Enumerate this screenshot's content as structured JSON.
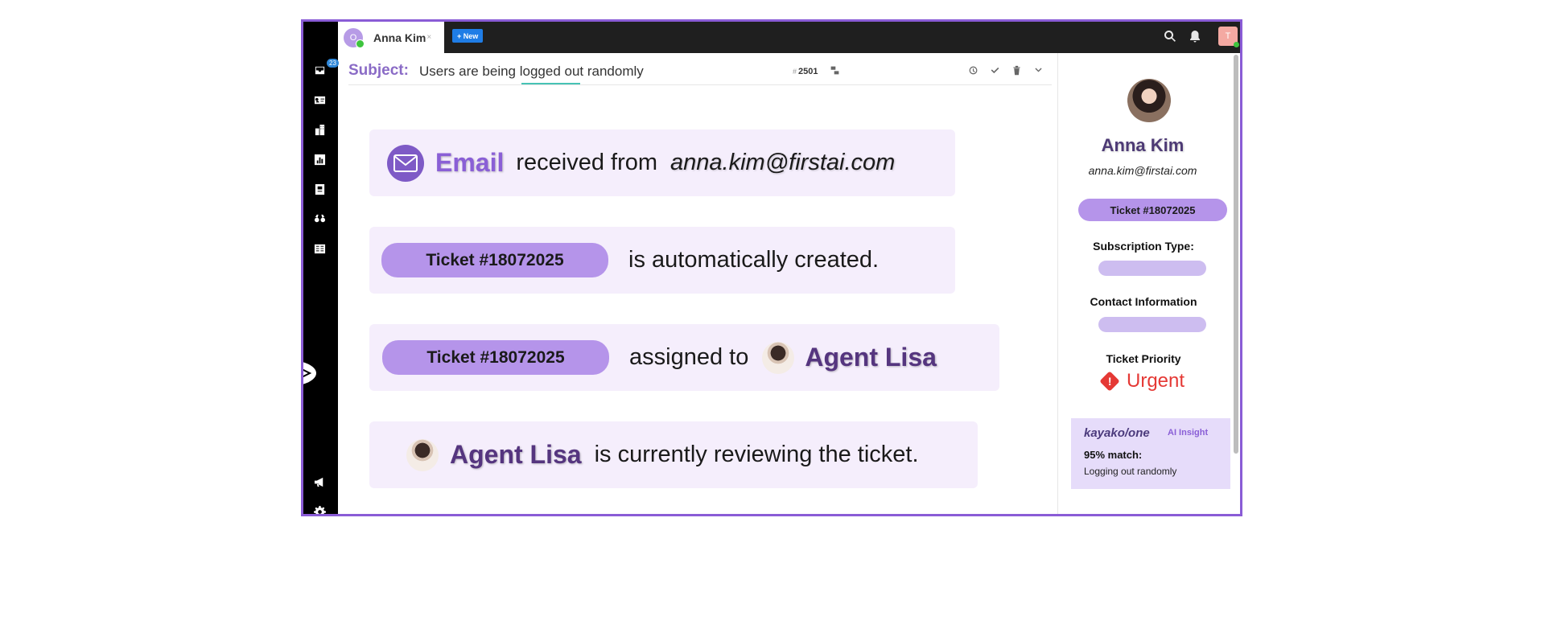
{
  "sidebar": {
    "inbox_badge": "23",
    "icons": [
      "inbox-icon",
      "contacts-icon",
      "organizations-icon",
      "reports-icon",
      "knowledge-base-icon",
      "monitor-icon",
      "book-icon",
      "megaphone-icon",
      "gear-icon"
    ]
  },
  "topbar": {
    "tab_avatar_initial": "O",
    "tab_name": "Anna Kim",
    "tab_close": "×",
    "new_button": "+ New",
    "user_initial": "T"
  },
  "subject": {
    "label": "Subject:",
    "text": "Users are being logged out randomly",
    "hash": "#",
    "ticket_number": "2501"
  },
  "cards": {
    "email_word": "Email",
    "received_from": "received from",
    "email_address": "anna.kim@firstai.com",
    "ticket_pill": "Ticket #18072025",
    "auto_created": "is automatically created.",
    "assigned_to": "assigned to",
    "agent_name": "Agent Lisa",
    "reviewing": "is currently reviewing the ticket."
  },
  "right_panel": {
    "name": "Anna Kim",
    "email": "anna.kim@firstai.com",
    "ticket_pill": "Ticket #18072025",
    "subscription_label": "Subscription Type:",
    "contact_label": "Contact Information",
    "priority_label": "Ticket Priority",
    "priority_value": "Urgent",
    "insight": {
      "brand": "kayako/one",
      "ai_label": "AI Insight",
      "match": "95% match:",
      "description": "Logging out randomly"
    }
  },
  "colors": {
    "frame_border": "#8a5cd6",
    "pill": "#b594ea",
    "card_bg": "#f5eefc",
    "urgent": "#e53935",
    "new_button": "#1f7de6"
  }
}
